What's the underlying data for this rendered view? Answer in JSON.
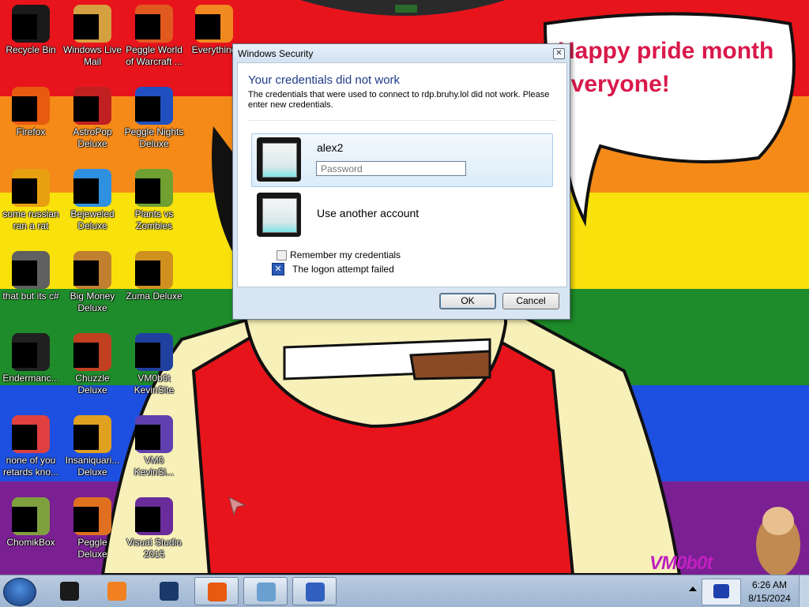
{
  "desktop": {
    "background_colors": [
      "#e8141c",
      "#f58a18",
      "#f9e10c",
      "#1e8c2a",
      "#1d50e0",
      "#7a2093"
    ],
    "speech_bubble": "Happy pride month everyone!",
    "signature": "VM0b0t",
    "icons": [
      {
        "label": "Recycle Bin",
        "color": "#1a1a1a"
      },
      {
        "label": "Windows Live Mail",
        "color": "#d4a040"
      },
      {
        "label": "Peggle World of Warcraft ...",
        "color": "#e05a20"
      },
      {
        "label": "Everything",
        "color": "#f08a20"
      },
      {
        "label": "Firefox",
        "color": "#e85a10"
      },
      {
        "label": "AstroPop Deluxe",
        "color": "#c02020"
      },
      {
        "label": "Peggle Nights Deluxe",
        "color": "#2050c0"
      },
      {
        "label": "some russian ran a rat",
        "color": "#e8a010"
      },
      {
        "label": "Bejeweled Deluxe",
        "color": "#3090e0"
      },
      {
        "label": "Plants vs Zombies",
        "color": "#70a030"
      },
      {
        "label": "that but its c#",
        "color": "#606060"
      },
      {
        "label": "Big Money Deluxe",
        "color": "#c08030"
      },
      {
        "label": "Zuma Deluxe",
        "color": "#d09020"
      },
      {
        "label": "Endermanc...",
        "color": "#202020"
      },
      {
        "label": "Chuzzle Deluxe",
        "color": "#c04020"
      },
      {
        "label": "VM0b0t KevinSite",
        "color": "#2040a0"
      },
      {
        "label": "none of you retards kno...",
        "color": "#e04040"
      },
      {
        "label": "Insaniquari... Deluxe",
        "color": "#e0a020"
      },
      {
        "label": "VM0 KevinSi...",
        "color": "#6040b0"
      },
      {
        "label": "ChomikBox",
        "color": "#80a040"
      },
      {
        "label": "Peggle Deluxe",
        "color": "#e07020"
      },
      {
        "label": "Visual Studio 2015",
        "color": "#6a2c9a"
      }
    ]
  },
  "dialog": {
    "title": "Windows Security",
    "close_glyph": "✕",
    "heading": "Your credentials did not work",
    "message": "The credentials that were used to connect to rdp.bruhy.lol did not work. Please enter new credentials.",
    "account_name": "alex2",
    "password_placeholder": "Password",
    "password_value": "",
    "other_account": "Use another account",
    "remember_label": "Remember my credentials",
    "remember_checked": false,
    "error_icon": "x-icon",
    "error_text": "The logon attempt failed",
    "ok_label": "OK",
    "cancel_label": "Cancel"
  },
  "taskbar": {
    "items": [
      {
        "name": "taskbar-item-console",
        "color": "#1a1a1a",
        "active": false
      },
      {
        "name": "taskbar-item-media-player",
        "color": "#f08020",
        "active": false
      },
      {
        "name": "taskbar-item-app-globe",
        "color": "#1a3a6a",
        "active": false
      },
      {
        "name": "taskbar-item-firefox",
        "color": "#e85a10",
        "active": true
      },
      {
        "name": "taskbar-item-notepad",
        "color": "#6aa0d0",
        "active": true
      },
      {
        "name": "taskbar-item-remote-desktop",
        "color": "#3060c0",
        "active": true
      }
    ],
    "clock_time": "6:26 AM",
    "clock_date": "8/15/2024"
  }
}
